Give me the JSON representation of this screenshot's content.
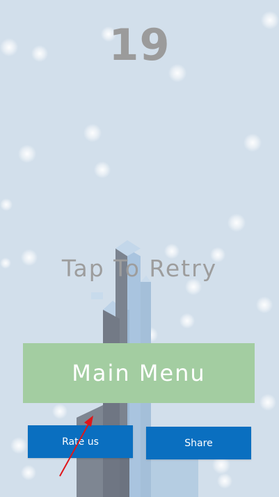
{
  "game": {
    "score": "19",
    "retry_label": "Tap To Retry"
  },
  "buttons": {
    "main_menu": "Main Menu",
    "rate_us": "Rate us",
    "share": "Share"
  },
  "colors": {
    "background": "#d2dfeb",
    "main_menu_button": "#a3cda1",
    "small_buttons": "#0a6fc0",
    "annotation_arrow": "#e0161a"
  }
}
